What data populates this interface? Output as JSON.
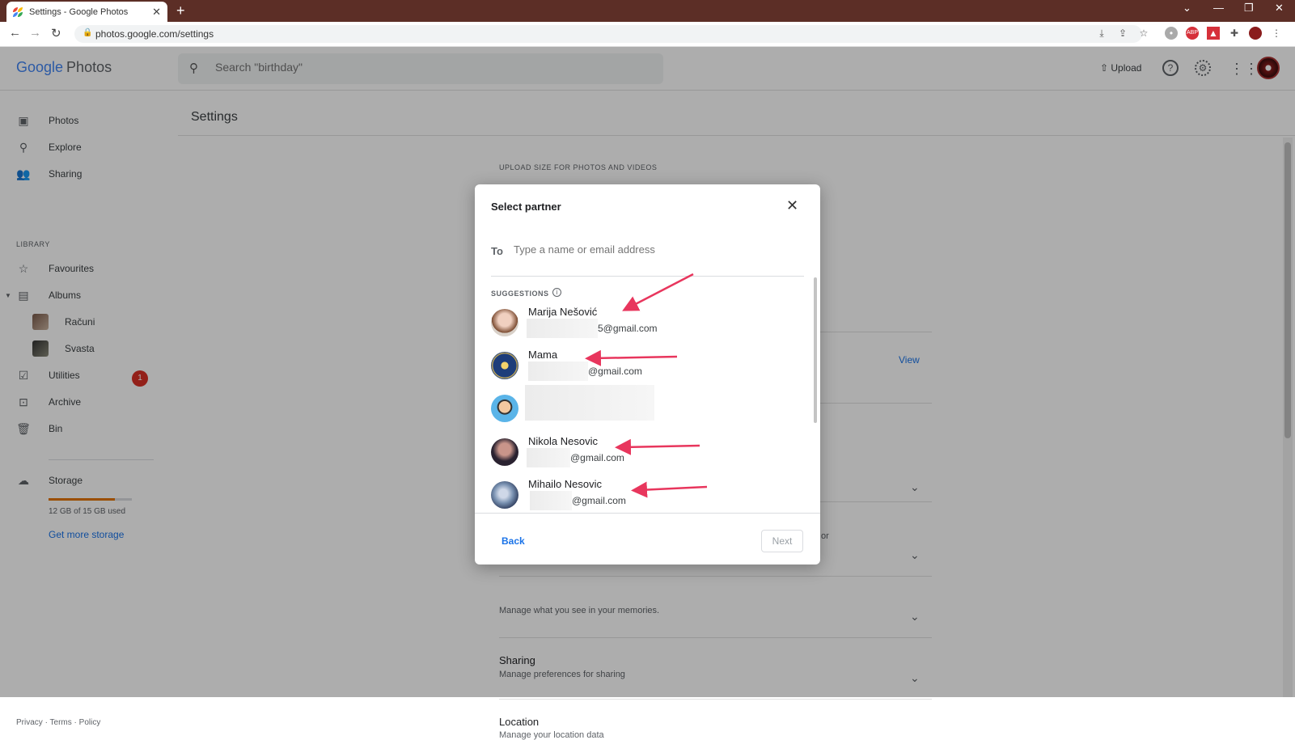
{
  "browser": {
    "tab_title": "Settings - Google Photos",
    "url": "photos.google.com/settings",
    "new_tab_symbol": "+"
  },
  "header": {
    "logo_google": "Google",
    "logo_photos": "Photos",
    "search_placeholder": "Search \"birthday\"",
    "upload_label": "Upload"
  },
  "sidebar": {
    "items": [
      {
        "label": "Photos"
      },
      {
        "label": "Explore"
      },
      {
        "label": "Sharing"
      }
    ],
    "library_label": "LIBRARY",
    "library_items": [
      {
        "label": "Favourites"
      },
      {
        "label": "Albums"
      },
      {
        "label": "Računi"
      },
      {
        "label": "Svasta"
      },
      {
        "label": "Utilities",
        "badge": "1"
      },
      {
        "label": "Archive"
      },
      {
        "label": "Bin"
      }
    ],
    "storage": {
      "label": "Storage",
      "used_text": "12 GB of 15 GB used",
      "used_fraction": 0.8,
      "cta": "Get more storage"
    },
    "footer": {
      "privacy": "Privacy",
      "terms": "Terms",
      "policy": "Policy",
      "separator": "·"
    }
  },
  "main": {
    "title": "Settings",
    "upload_section_label": "UPLOAD SIZE FOR PHOTOS AND VIDEOS",
    "view_link": "View",
    "partial_text_or": "or",
    "memories_sub": "Manage what you see in your memories.",
    "sharing": {
      "title": "Sharing",
      "sub": "Manage preferences for sharing"
    },
    "location": {
      "title": "Location",
      "sub": "Manage your location data"
    }
  },
  "dialog": {
    "title": "Select partner",
    "to_label": "To",
    "to_placeholder": "Type a name or email address",
    "suggestions_label": "SUGGESTIONS",
    "suggestions": [
      {
        "name": "Marija Nešović",
        "email": "5@gmail.com"
      },
      {
        "name": "Mama",
        "email": "@gmail.com"
      },
      {
        "name": "",
        "email": ""
      },
      {
        "name": "Nikola Nesovic",
        "email": "@gmail.com"
      },
      {
        "name": "Mihailo Nesovic",
        "email": "@gmail.com"
      }
    ],
    "back_label": "Back",
    "next_label": "Next"
  },
  "colors": {
    "accent": "#1a73e8",
    "arrow": "#e8365d",
    "badge": "#d93025",
    "storage_fill": "#e37400"
  }
}
